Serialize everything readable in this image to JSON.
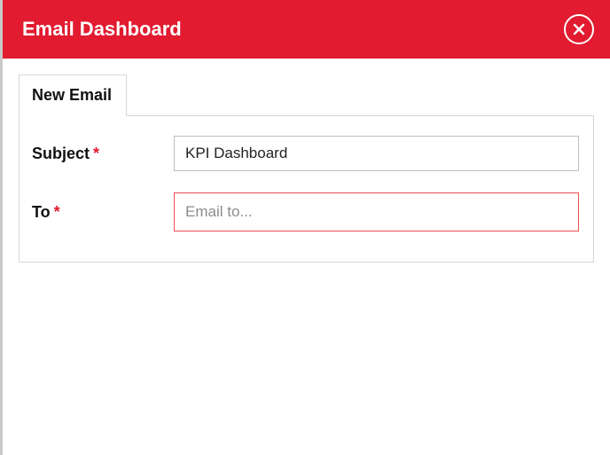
{
  "header": {
    "title": "Email Dashboard"
  },
  "tabs": {
    "new_email": "New Email"
  },
  "form": {
    "subject": {
      "label": "Subject",
      "required": "*",
      "value": "KPI Dashboard"
    },
    "to": {
      "label": "To",
      "required": "*",
      "placeholder": "Email to...",
      "value": ""
    }
  }
}
